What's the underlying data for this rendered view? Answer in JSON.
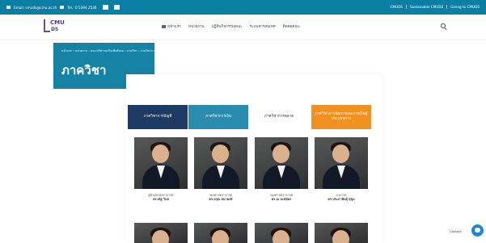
{
  "topbar": {
    "email": "Email: cmuds@cmu.ac.th",
    "tel": "Tel.: 0 5394 2536",
    "links": [
      "CMUDS",
      "Sustainable CMUDS",
      "Giving to CMUDS"
    ]
  },
  "logo": {
    "line1": "CMU",
    "line2": "DS"
  },
  "nav": {
    "items": [
      "หน้าแรก",
      "หน่วยงาน",
      "ปฏิทินกิจกรรมคณะ",
      "ระบบสารสนเทศ",
      "ติดต่อคณะ"
    ]
  },
  "hero": {
    "breadcrumb": "หน้าแรก › หน่วยงาน › คณะบริหารธุรกิจเพื่อสังคม › ภาควิชา › ภาควิชาการตลาด",
    "title": "ภาควิชา"
  },
  "tabs": [
    {
      "label": "ภาควิชาการบัญชี",
      "color": "#1c3a63"
    },
    {
      "label": "ภาควิชาการเงิน",
      "color": "#2a8db0"
    },
    {
      "label": "ภาควิชาการตลาด",
      "color": "#ffffff"
    },
    {
      "label": "ภาควิชาการจัดการและการเป็นผู้ประกอบการ",
      "color": "#f19122"
    }
  ],
  "staff": [
    {
      "position": "ผู้ช่วยศาสตราจารย์",
      "name": "ดร.ณัฐ วิมล"
    },
    {
      "position": "รองศาสตราจารย์",
      "name": "ดร.อรุณ ธนาพงษ์"
    },
    {
      "position": "รองศาสตราจารย์",
      "name": "ดร.ณ ละมัยพร"
    },
    {
      "position": "อาจารย์",
      "name": "ดร.ประภาพันธุ์ สุขุม"
    }
  ],
  "chat": {
    "label": "Contact"
  },
  "colors": {
    "primary": "#0b7fa3",
    "hero": "#1683a4",
    "accent": "#f19122"
  }
}
